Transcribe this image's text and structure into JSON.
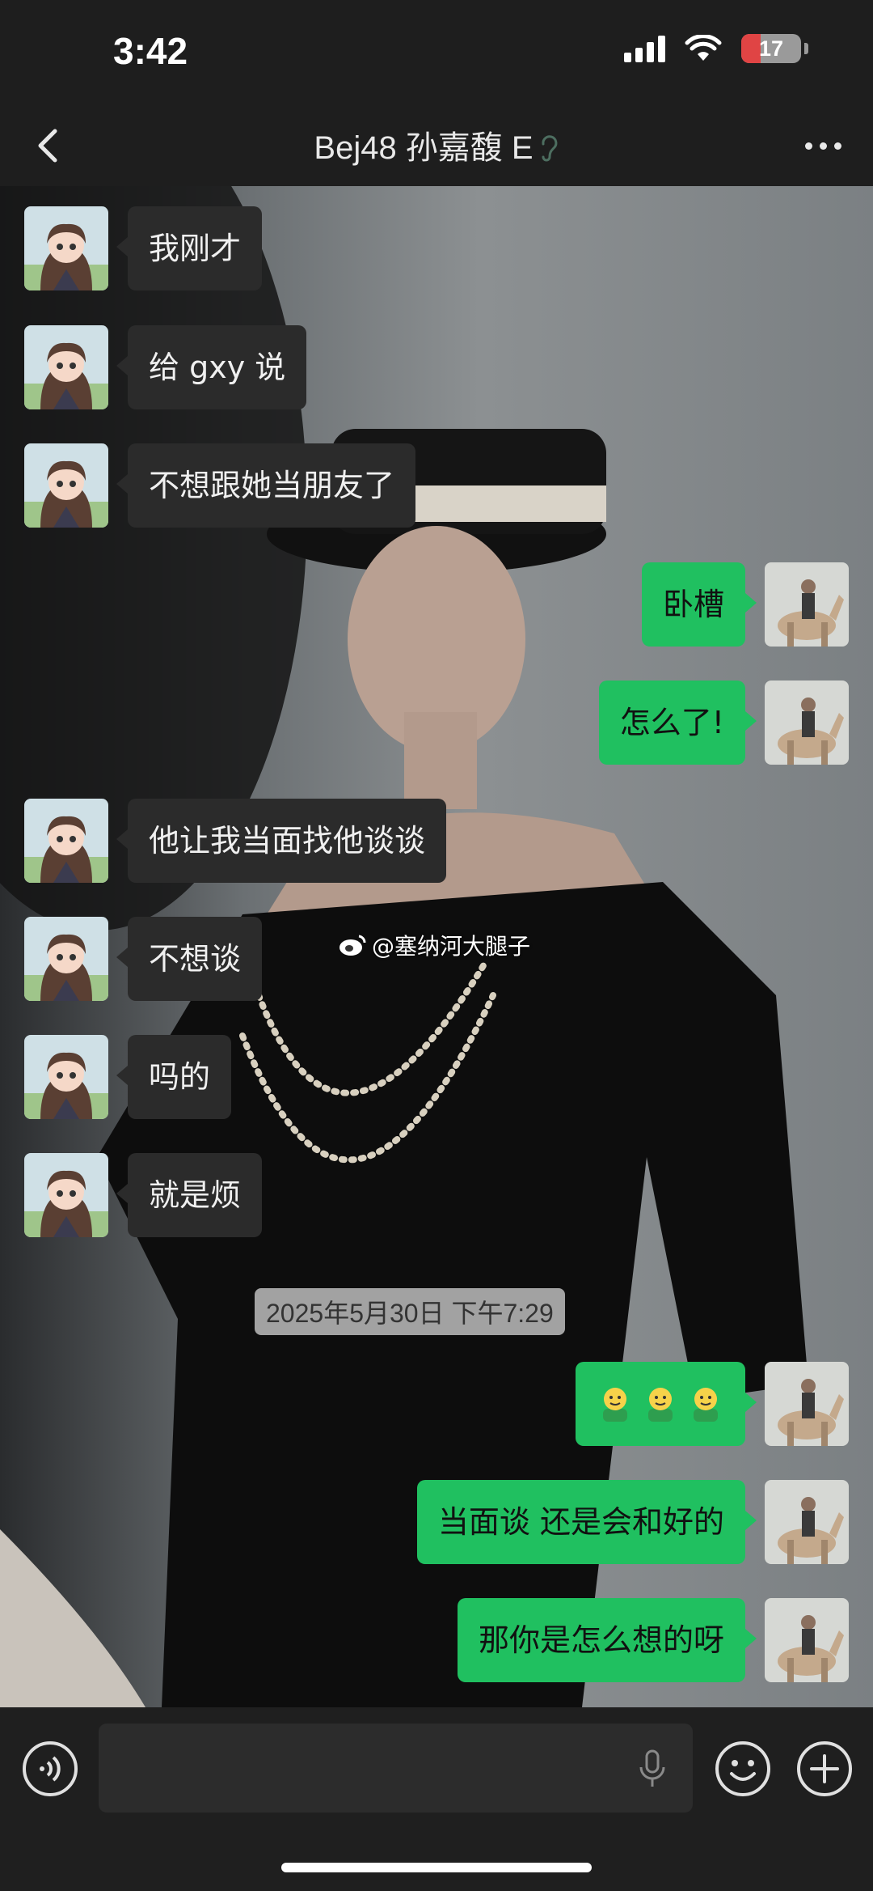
{
  "status_bar": {
    "time": "3:42",
    "battery_level": "17"
  },
  "header": {
    "title": "Bej48 孙嘉馥 E"
  },
  "watermark": {
    "text": "@塞纳河大腿子"
  },
  "messages": [
    {
      "side": "left",
      "text": "我刚才"
    },
    {
      "side": "left",
      "text": "给 gxy 说"
    },
    {
      "side": "left",
      "text": "不想跟她当朋友了"
    },
    {
      "side": "right",
      "text": "卧槽"
    },
    {
      "side": "right",
      "text": "怎么了!"
    },
    {
      "side": "left",
      "text": "他让我当面找他谈谈"
    },
    {
      "side": "left",
      "text": "不想谈"
    },
    {
      "side": "left",
      "text": "吗的"
    },
    {
      "side": "left",
      "text": "就是烦"
    },
    {
      "side": "right",
      "text": "",
      "emoji": "face-emoji x3"
    },
    {
      "side": "right",
      "text": "当面谈 还是会和好的"
    },
    {
      "side": "right",
      "text": "那你是怎么想的呀"
    }
  ],
  "timestamp": "2025年5月30日 下午7:29",
  "colors": {
    "bubble_sent": "#20c060",
    "bubble_received": "#2b2b2b",
    "battery_low": "#e04444"
  },
  "icons": {
    "back": "chevron-left-icon",
    "more": "more-dots-icon",
    "voice": "voice-mode-icon",
    "mic": "microphone-icon",
    "emoji": "emoji-icon",
    "plus": "plus-icon"
  }
}
